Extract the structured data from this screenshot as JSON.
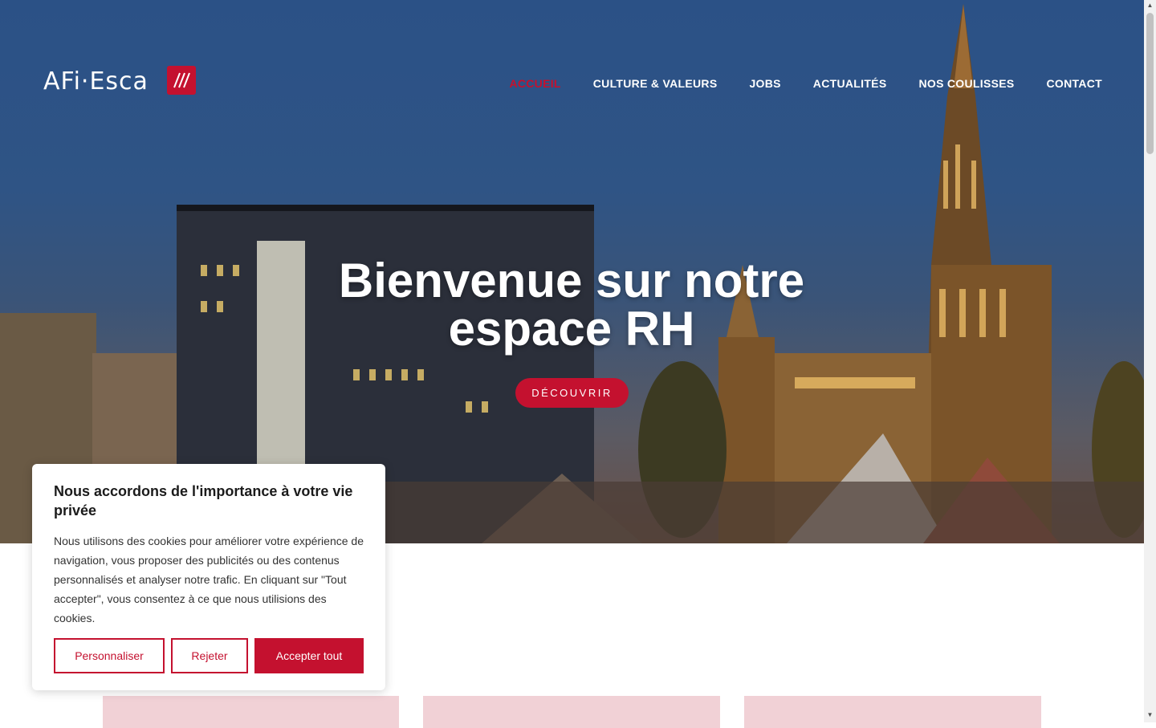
{
  "brand": {
    "logo_text": "AFi·Esca",
    "badge_icon": "afi-esca-emblem-icon",
    "color": "#c4112f"
  },
  "nav": {
    "items": [
      {
        "label": "ACCUEIL",
        "active": true
      },
      {
        "label": "CULTURE & VALEURS",
        "active": false
      },
      {
        "label": "JOBS",
        "active": false
      },
      {
        "label": "ACTUALITÉS",
        "active": false
      },
      {
        "label": "NOS COULISSES",
        "active": false
      },
      {
        "label": "CONTACT",
        "active": false
      }
    ]
  },
  "hero": {
    "title": "Bienvenue sur notre espace RH",
    "cta_label": "DÉCOUVRIR"
  },
  "cookie_banner": {
    "title": "Nous accordons de l'importance à votre vie privée",
    "body": "Nous utilisons des cookies pour améliorer votre expérience de navigation, vous proposer des publicités ou des contenus personnalisés et analyser notre trafic. En cliquant sur \"Tout accepter\", vous consentez à ce que nous utilisions des cookies.",
    "buttons": {
      "customize": "Personnaliser",
      "reject": "Rejeter",
      "accept": "Accepter tout"
    }
  },
  "colors": {
    "accent": "#c4112f",
    "card_bg": "#f1d1d6"
  }
}
